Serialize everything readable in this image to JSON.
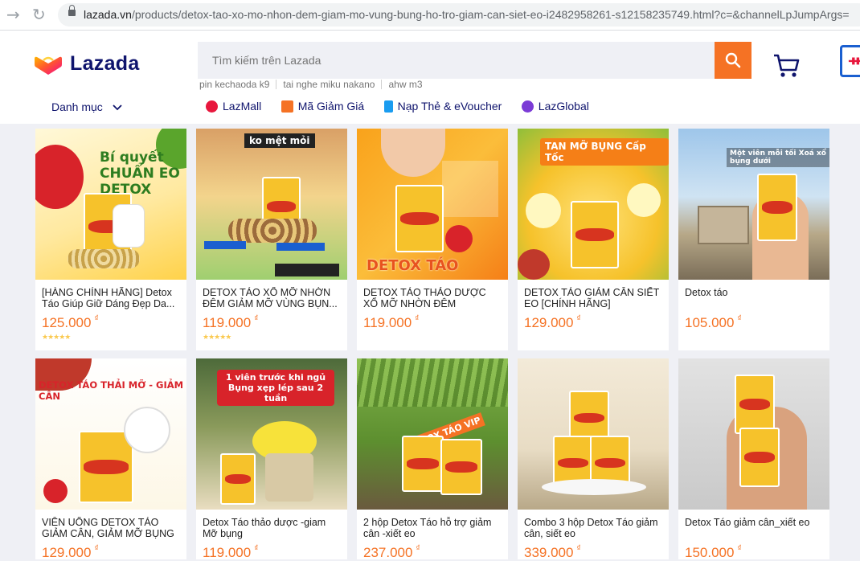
{
  "browser": {
    "url_host": "lazada.vn",
    "url_path": "/products/detox-tao-xo-mo-nhon-dem-giam-mo-vung-bung-ho-tro-giam-can-siet-eo-i2482958261-s12158235749.html?c=&channelLpJumpArgs="
  },
  "header": {
    "logo_text": "Lazada",
    "search_placeholder": "Tìm kiếm trên Lazada",
    "suggestions": [
      "pin kechaoda k9",
      "tai nghe miku nakano",
      "ahw m3"
    ],
    "category_label": "Danh mục",
    "links": [
      {
        "label": "LazMall",
        "color": "#e8173d"
      },
      {
        "label": "Mã Giảm Giá",
        "color": "#f57224"
      },
      {
        "label": "Nạp Thẻ & eVoucher",
        "color": "#1a9cf0"
      },
      {
        "label": "LazGlobal",
        "color": "#7b3bd6"
      }
    ],
    "right_badge_glyph": "ᚔ"
  },
  "colors": {
    "accent": "#f57224",
    "brand_navy": "#0f146d",
    "page_bg": "#eff0f5"
  },
  "products": [
    {
      "title": "[HÀNG CHÍNH HÃNG] Detox Táo Giúp Giữ Dáng Đẹp Da...",
      "price": "125.000",
      "currency": "₫",
      "rating_stars": 5,
      "image_caption": "Bí quyết CHUẨN EO DETOX TÁO"
    },
    {
      "title": "DETOX TÁO XỔ MỠ NHỜN ĐÊM GIẢM MỠ VÙNG BỤN...",
      "price": "119.000",
      "currency": "₫",
      "rating_stars": 5,
      "image_caption": "ko mệt mỏi"
    },
    {
      "title": "DETOX TÁO THẢO DƯỢC XỔ MỠ NHỜN ĐÊM",
      "price": "119.000",
      "currency": "₫",
      "rating_stars": 0,
      "image_caption": "DETOX TÁO"
    },
    {
      "title": "DETOX TÁO GIẢM CÂN SIẾT EO [CHÍNH HÃNG]",
      "price": "129.000",
      "currency": "₫",
      "rating_stars": 0,
      "image_caption": "TAN MỠ BỤNG Cấp Tốc"
    },
    {
      "title": "Detox táo",
      "price": "105.000",
      "currency": "₫",
      "rating_stars": 0,
      "image_caption": "Một viên mỗi tối Xoá xổ bụng dưới"
    },
    {
      "title": "VIÊN UỐNG DETOX TÁO GIẢM CÂN, GIẢM MỠ BỤNG",
      "price": "129.000",
      "currency": "₫",
      "rating_stars": 0,
      "image_caption": "DETOX TÁO THẢI MỠ - GIẢM CÂN"
    },
    {
      "title": "Detox Táo thảo dược -giam Mỡ bụng",
      "price": "119.000",
      "currency": "₫",
      "rating_stars": 0,
      "image_caption": "1 viên trước khi ngủ Bụng xẹp lép sau 2 tuần"
    },
    {
      "title": "2 hộp Detox Táo hỗ trợ giảm cân -xiết eo",
      "price": "237.000",
      "currency": "₫",
      "rating_stars": 0,
      "image_caption": "DETOX TÁO VIP"
    },
    {
      "title": "Combo 3 hộp Detox Táo giảm cân, siết eo",
      "price": "339.000",
      "currency": "₫",
      "rating_stars": 0,
      "image_caption": ""
    },
    {
      "title": "Detox Táo giảm cân_xiết eo",
      "price": "150.000",
      "currency": "₫",
      "rating_stars": 0,
      "image_caption": ""
    }
  ]
}
